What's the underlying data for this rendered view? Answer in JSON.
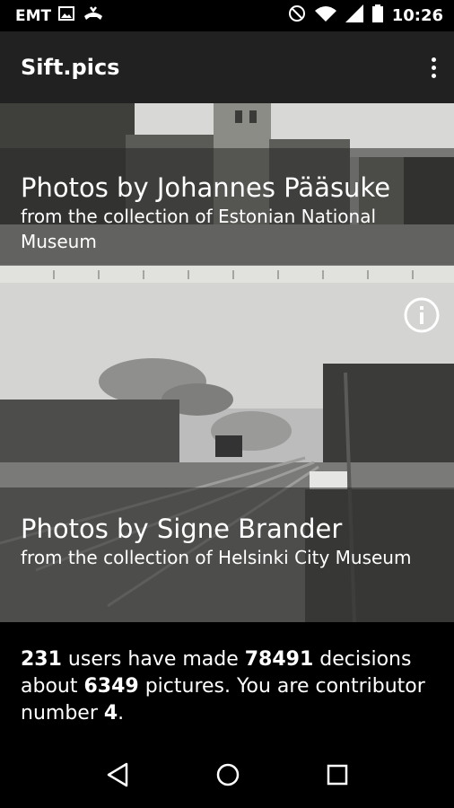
{
  "status": {
    "carrier": "EMT",
    "time": "10:26",
    "icons": [
      "image-icon",
      "voicemail-icon",
      "dnd-icon",
      "wifi-icon",
      "signal-icon",
      "battery-icon"
    ]
  },
  "app": {
    "title": "Sift.pics",
    "menu_icon": "more-vert-icon"
  },
  "collections": [
    {
      "title": "Photos by Johannes Pääsuke",
      "subtitle": "from the collection of Estonian National Museum"
    },
    {
      "title": "Photos by Signe Brander",
      "subtitle": "from the collection of Helsinki City Museum",
      "icon": "info-icon"
    }
  ],
  "stats": {
    "users": "231",
    "text1": " users have made ",
    "decisions": "78491",
    "text2": " decisions about ",
    "pictures": "6349",
    "text3": " pictures. You are contributor number ",
    "contributor": "4",
    "text4": "."
  },
  "nav": [
    "back-icon",
    "home-icon",
    "recents-icon"
  ]
}
